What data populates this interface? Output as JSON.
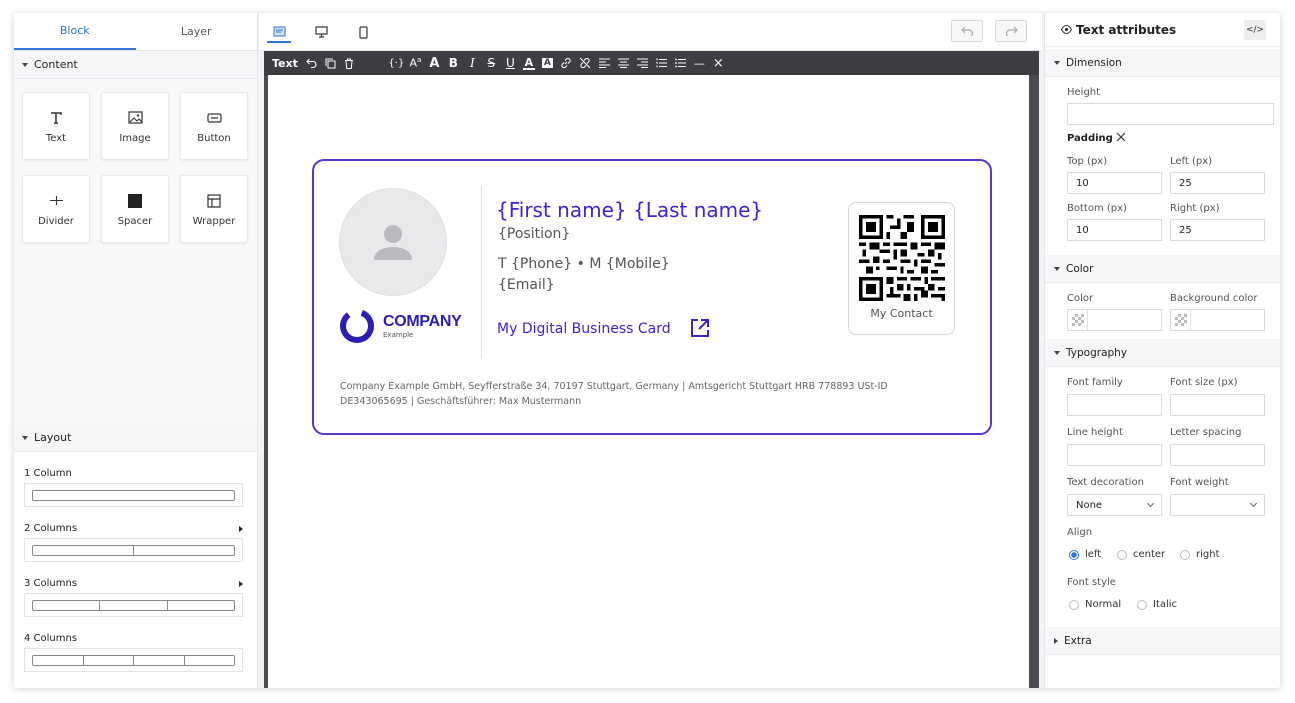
{
  "left_panel": {
    "tabs": [
      "Block",
      "Layer"
    ],
    "content_header": "Content",
    "blocks": [
      {
        "label": "Text",
        "icon": "text-icon"
      },
      {
        "label": "Image",
        "icon": "image-icon"
      },
      {
        "label": "Button",
        "icon": "button-icon"
      },
      {
        "label": "Divider",
        "icon": "divider-icon"
      },
      {
        "label": "Spacer",
        "icon": "spacer-icon"
      },
      {
        "label": "Wrapper",
        "icon": "wrapper-icon"
      }
    ],
    "layout_header": "Layout",
    "layouts": [
      "1 Column",
      "2 Columns",
      "3 Columns",
      "4 Columns"
    ]
  },
  "center": {
    "devices": [
      "email-view-icon",
      "desktop-icon",
      "mobile-icon"
    ],
    "toolbar": {
      "text_label": "Text",
      "bold": "B",
      "italic": "I",
      "strike": "S",
      "underline": "U",
      "font_color": "A",
      "highlight": "A",
      "hr": "—",
      "clear": "×"
    },
    "card": {
      "name": "{First name} {Last name}",
      "position": "{Position}",
      "phone": "T {Phone} • M {Mobile}",
      "email": "{Email}",
      "link_text": "My Digital Business Card",
      "company_name": "COMPANY",
      "company_sub": "Example",
      "qr_label": "My Contact",
      "footer": "Company Example GmbH, Seyfferstraße 34, 70197 Stuttgart, Germany | Amtsgericht Stuttgart HRB 778893 USt-ID DE343065695 | Geschäftsführer: Max Mustermann"
    },
    "colors": {
      "brand": "#3b23d6",
      "border": "#4b3ad0",
      "active_tab": "#3174d8"
    }
  },
  "right_panel": {
    "title": "Text attributes",
    "code_label": "</>",
    "dimension": {
      "header": "Dimension",
      "height_label": "Height",
      "height_value": "",
      "padding_label": "Padding",
      "top_label": "Top (px)",
      "top_value": "10",
      "left_label": "Left (px)",
      "left_value": "25",
      "bottom_label": "Bottom (px)",
      "bottom_value": "10",
      "right_label": "Right (px)",
      "right_value": "25"
    },
    "color": {
      "header": "Color",
      "color_label": "Color",
      "bg_label": "Background color"
    },
    "typography": {
      "header": "Typography",
      "font_family_label": "Font family",
      "font_size_label": "Font size (px)",
      "line_height_label": "Line height",
      "letter_spacing_label": "Letter spacing",
      "text_decoration_label": "Text decoration",
      "text_decoration_value": "None",
      "font_weight_label": "Font weight",
      "font_weight_value": "",
      "align_label": "Align",
      "align_options": [
        "left",
        "center",
        "right"
      ],
      "align_selected": "left",
      "font_style_label": "Font style",
      "font_style_options": [
        "Normal",
        "Italic"
      ]
    },
    "extra_header": "Extra"
  }
}
